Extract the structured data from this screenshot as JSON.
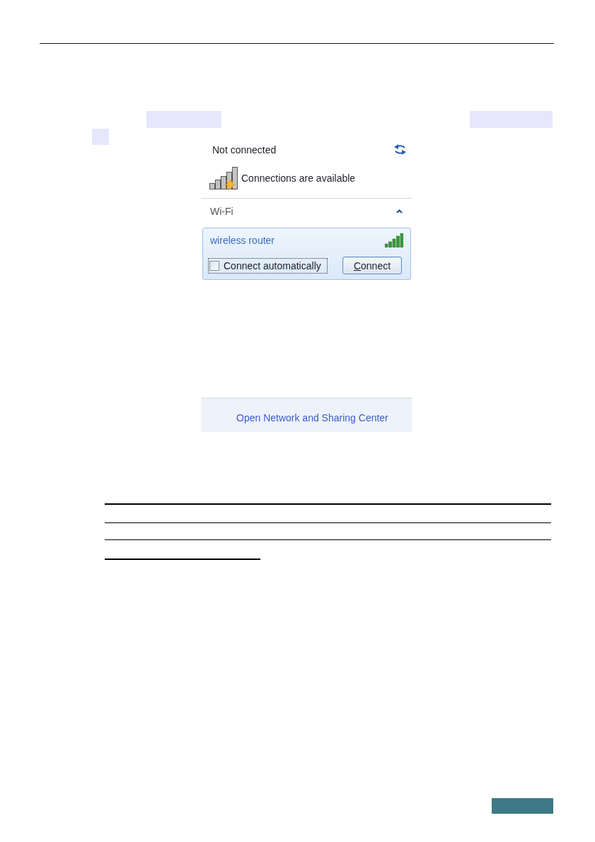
{
  "flyout": {
    "status": "Not connected",
    "availability": "Connections are available",
    "sections": [
      {
        "label": "Wi-Fi",
        "expanded": true,
        "networks": [
          {
            "name": "wireless router",
            "selected": true,
            "auto_connect": {
              "label": "Connect automatically",
              "checked": false,
              "focused": true
            },
            "connect_button": {
              "label": "Connect",
              "access_key_shown": true
            }
          }
        ]
      }
    ],
    "footer_link": "Open Network and Sharing Center"
  }
}
